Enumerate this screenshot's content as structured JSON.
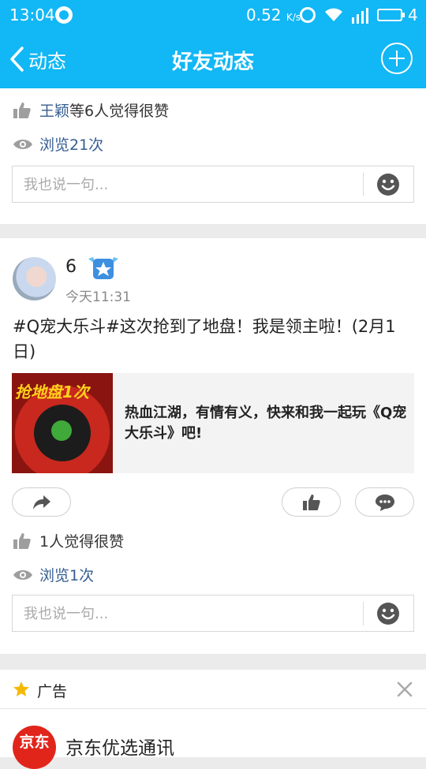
{
  "status_bar": {
    "time": "13:04",
    "net_speed": "0.52",
    "net_speed_unit": "K/s",
    "battery": "4"
  },
  "title_bar": {
    "back_label": "动态",
    "title": "好友动态"
  },
  "feed": [
    {
      "likes_name": "王颖",
      "likes_suffix": "等6人觉得很赞",
      "views": "浏览21次",
      "comment_placeholder": "我也说一句..."
    },
    {
      "username": "6",
      "time": "今天11:31",
      "text": "#Q宠大乐斗#这次抢到了地盘！我是领主啦！(2月1日)",
      "share": {
        "thumb_title": "抢地盘1次",
        "text": "热血江湖，有情有义，快来和我一起玩《Q宠大乐斗》吧!"
      },
      "likes_text": "1人觉得很赞",
      "views": "浏览1次",
      "comment_placeholder": "我也说一句..."
    }
  ],
  "ad": {
    "label": "广告",
    "logo_text": "京东",
    "name": "京东优选通讯"
  },
  "colors": {
    "brand_blue": "#12b7f5",
    "link_blue": "#355e92",
    "icon_grey": "#9e9e9e"
  }
}
